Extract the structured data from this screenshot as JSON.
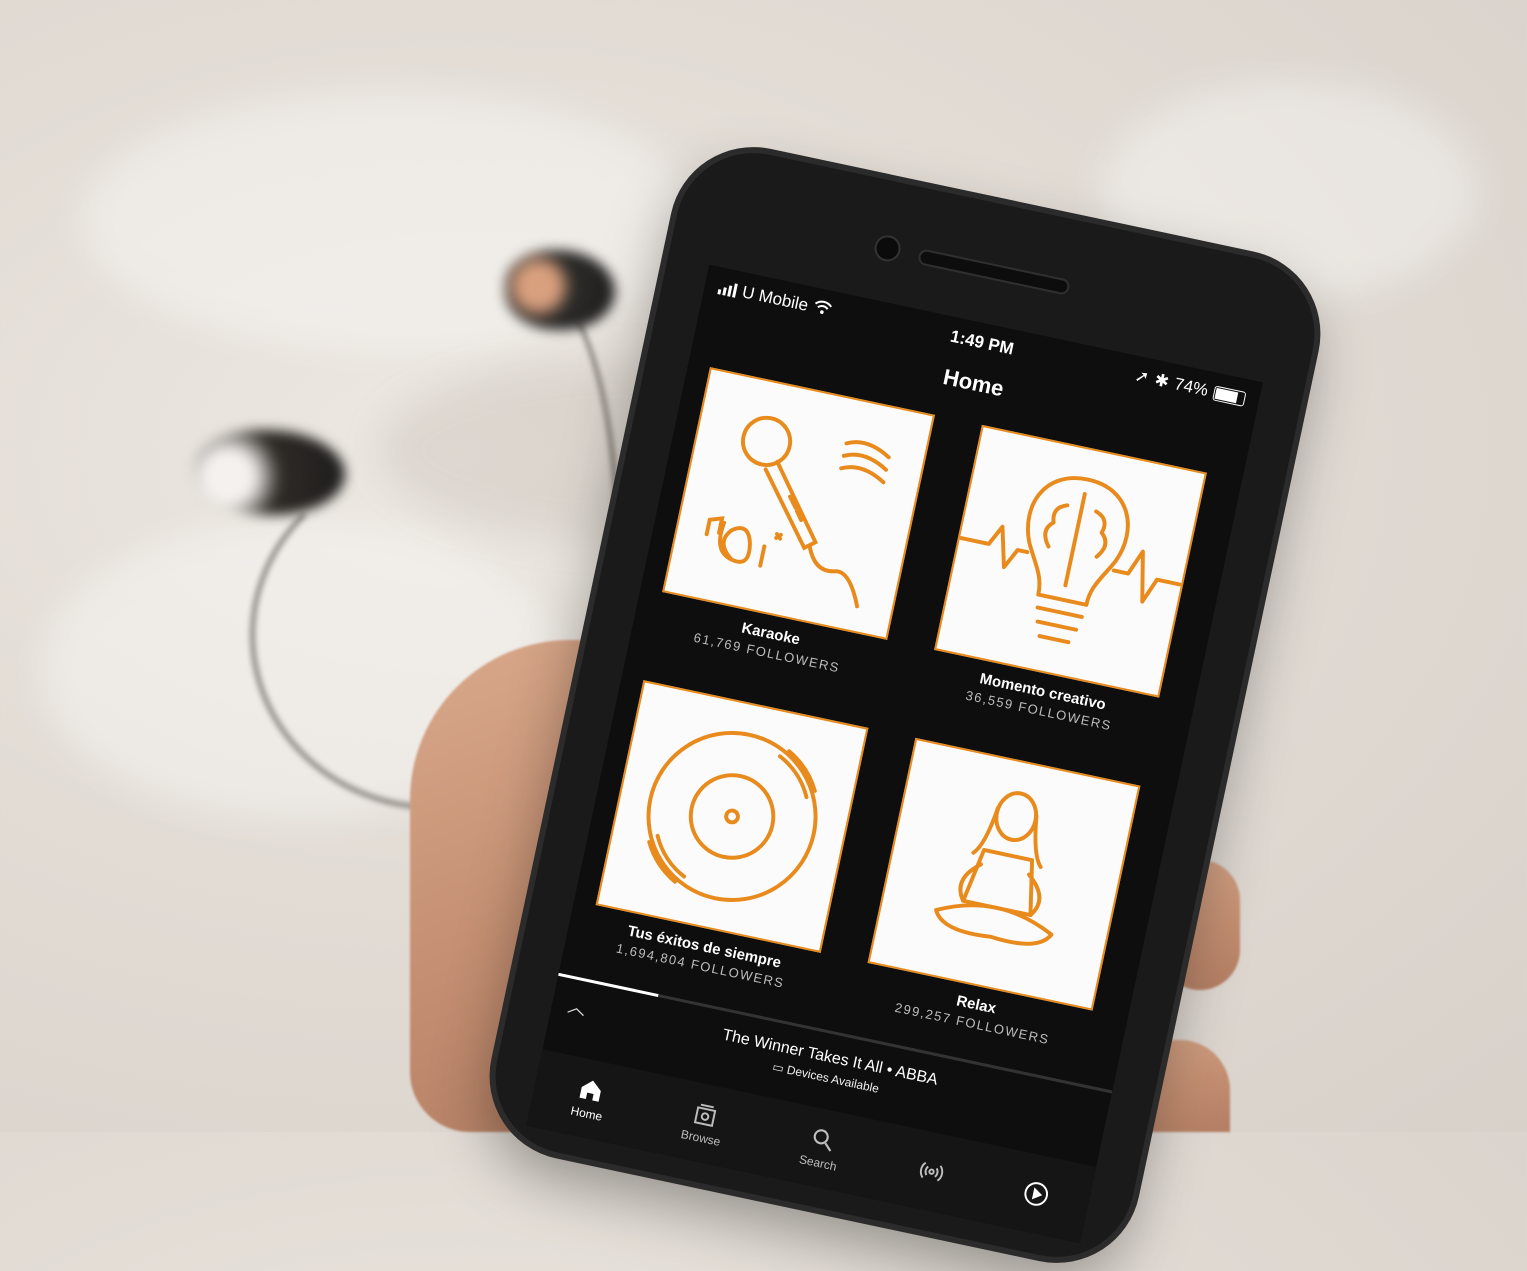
{
  "status_bar": {
    "carrier": "U Mobile",
    "time": "1:49 PM",
    "battery": "74%",
    "battery_level": 0.74
  },
  "header": {
    "title": "Home"
  },
  "playlists": [
    {
      "name": "Karaoke",
      "followers": "61,769 FOLLOWERS",
      "icon": "microphone-icon"
    },
    {
      "name": "Momento creativo",
      "followers": "36,559 FOLLOWERS",
      "icon": "lightbulb-brain-icon"
    },
    {
      "name": "Tus éxitos de siempre",
      "followers": "1,694,804 FOLLOWERS",
      "icon": "vinyl-record-icon"
    },
    {
      "name": "Relax",
      "followers": "299,257 FOLLOWERS",
      "icon": "meditation-icon"
    }
  ],
  "now_playing": {
    "track": "The Winner Takes It All • ABBA",
    "devices": "Devices Available"
  },
  "tabs": [
    {
      "label": "Home",
      "icon": "home-icon",
      "active": true
    },
    {
      "label": "Browse",
      "icon": "browse-icon",
      "active": false
    },
    {
      "label": "Search",
      "icon": "search-icon",
      "active": false
    },
    {
      "label": "",
      "icon": "radio-icon",
      "active": false
    },
    {
      "label": "",
      "icon": "play-icon",
      "active": false
    }
  ],
  "colors": {
    "accent": "#e88a1c",
    "screen_bg": "#0e0e0e",
    "tile_bg": "#fbfbfb"
  }
}
